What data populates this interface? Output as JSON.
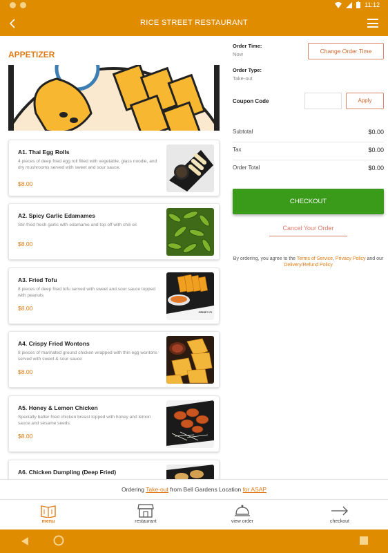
{
  "status_bar": {
    "time": "11:12"
  },
  "header": {
    "title": "RICE STREET RESTAURANT"
  },
  "section": {
    "title": "APPETIZER"
  },
  "menu_items": [
    {
      "name": "A1. Thai Egg Rolls",
      "desc": "4 pieces of deep fried egg roll filled with vegetable, glass noodle, and dry mushrooms served with sweet and sour sauce.",
      "price": "$8.00"
    },
    {
      "name": "A2. Spicy Garlic Edamames",
      "desc": "Stir-fried fresh garlic with edamame and top off with chili oil",
      "price": "$8.00"
    },
    {
      "name": "A3. Fried Tofu",
      "desc": "8 pieces of deep fried tofu served with sweet and sour sauce topped with peanuts",
      "price": "$8.00",
      "thumb_text": "CRISPY FI"
    },
    {
      "name": "A4. Crispy Fried Wontons",
      "desc": "8 pieces of marinated ground chicken wrapped with thin egg wontons served with sweet & sour sauce",
      "price": "$8.00"
    },
    {
      "name": "A5. Honey & Lemon Chicken",
      "desc": "Specialty batter fried chicken breast topped with honey and lemon sauce and sesame seeds.",
      "price": "$8.00"
    },
    {
      "name": "A6. Chicken Dumpling (Deep Fried)",
      "desc": "",
      "price": ""
    }
  ],
  "order": {
    "time_label": "Order Time:",
    "time_value": "Now",
    "change_time_button": "Change Order Time",
    "type_label": "Order Type:",
    "type_value": "Take-out",
    "coupon_label": "Coupon Code",
    "coupon_value": "",
    "apply_button": "Apply",
    "subtotal_label": "Subtotal",
    "subtotal_value": "$0.00",
    "tax_label": "Tax",
    "tax_value": "$0.00",
    "total_label": "Order Total",
    "total_value": "$0.00",
    "checkout_button": "CHECKOUT",
    "cancel_button": "Cancel Your Order",
    "terms_prefix": "By ordering, you agree to the ",
    "terms_link": "Terms of Service",
    "terms_comma": ", ",
    "privacy_link": "Privacy Policy",
    "terms_mid": " and our ",
    "refund_link": "Delivery/Refund Policy"
  },
  "order_strip": {
    "prefix": "Ordering ",
    "type_link": "Take-out",
    "mid": " from Bell Gardens Location ",
    "asap_link": "for ASAP"
  },
  "bottom_nav": [
    {
      "label": "menu",
      "icon": "menu-book-icon"
    },
    {
      "label": "restaurant",
      "icon": "storefront-icon"
    },
    {
      "label": "view order",
      "icon": "cloche-icon"
    },
    {
      "label": "checkout",
      "icon": "arrow-right-icon"
    }
  ],
  "colors": {
    "brand": "#e08c00",
    "accent": "#e07a14",
    "checkout": "#3a9a1a"
  }
}
